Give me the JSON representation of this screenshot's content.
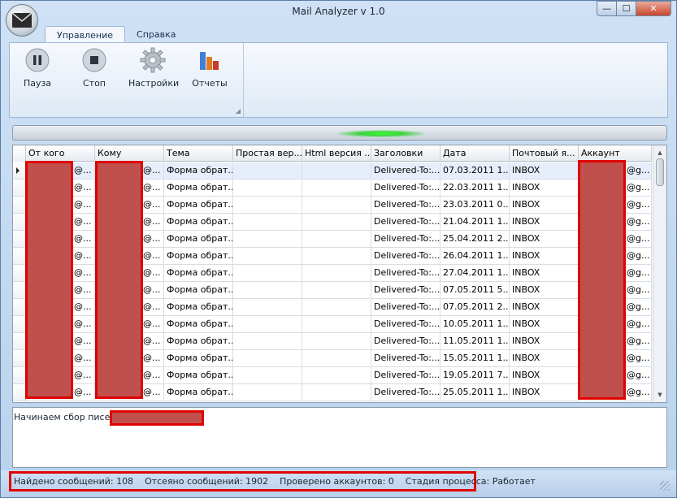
{
  "window": {
    "title": "Mail Analyzer v 1.0",
    "minimize": "—",
    "maximize": "☐",
    "close": "✕"
  },
  "tabs": [
    {
      "label": "Управление"
    },
    {
      "label": "Справка"
    }
  ],
  "ribbon": {
    "buttons": [
      {
        "label": "Пауза",
        "icon": "pause-icon"
      },
      {
        "label": "Стоп",
        "icon": "stop-icon"
      },
      {
        "label": "Настройки",
        "icon": "gear-icon"
      },
      {
        "label": "Отчеты",
        "icon": "chart-icon"
      }
    ]
  },
  "progress": {
    "indeterminate": true
  },
  "grid": {
    "columns": [
      "От кого",
      "Кому",
      "Тема",
      "Простая вер...",
      "Html версия ...",
      "Заголовки",
      "Дата",
      "Почтовый я...",
      "Аккаунт"
    ],
    "rows": [
      [
        "@...",
        "@...",
        "Форма обрат...",
        "",
        "",
        "Delivered-To:...",
        "07.03.2011 1...",
        "INBOX",
        "@g..."
      ],
      [
        "@...",
        "@...",
        "Форма обрат...",
        "",
        "",
        "Delivered-To:...",
        "22.03.2011 1...",
        "INBOX",
        "@g..."
      ],
      [
        "@...",
        "@...",
        "Форма обрат...",
        "",
        "",
        "Delivered-To:...",
        "23.03.2011 0...",
        "INBOX",
        "@g..."
      ],
      [
        "@...",
        "@...",
        "Форма обрат...",
        "",
        "",
        "Delivered-To:...",
        "21.04.2011 1...",
        "INBOX",
        "@g..."
      ],
      [
        "@...",
        "@...",
        "Форма обрат...",
        "",
        "",
        "Delivered-To:...",
        "25.04.2011 2...",
        "INBOX",
        "@g..."
      ],
      [
        "@...",
        "@...",
        "Форма обрат...",
        "",
        "",
        "Delivered-To:...",
        "26.04.2011 1...",
        "INBOX",
        "@g..."
      ],
      [
        "@...",
        "@...",
        "Форма обрат...",
        "",
        "",
        "Delivered-To:...",
        "27.04.2011 1...",
        "INBOX",
        "@g..."
      ],
      [
        "@...",
        "@...",
        "Форма обрат...",
        "",
        "",
        "Delivered-To:...",
        "07.05.2011 5...",
        "INBOX",
        "@g..."
      ],
      [
        "@...",
        "@...",
        "Форма обрат...",
        "",
        "",
        "Delivered-To:...",
        "07.05.2011 2...",
        "INBOX",
        "@g..."
      ],
      [
        "@...",
        "@...",
        "Форма обрат...",
        "",
        "",
        "Delivered-To:...",
        "10.05.2011 1...",
        "INBOX",
        "@g..."
      ],
      [
        "@...",
        "@...",
        "Форма обрат...",
        "",
        "",
        "Delivered-To:...",
        "11.05.2011 1...",
        "INBOX",
        "@g..."
      ],
      [
        "@...",
        "@...",
        "Форма обрат...",
        "",
        "",
        "Delivered-To:...",
        "15.05.2011 1...",
        "INBOX",
        "@g..."
      ],
      [
        "@...",
        "@...",
        "Форма обрат...",
        "",
        "",
        "Delivered-To:...",
        "19.05.2011 7...",
        "INBOX",
        "@g..."
      ],
      [
        "@...",
        "@...",
        "Форма обрат...",
        "",
        "",
        "Delivered-To:...",
        "25.05.2011 1...",
        "INBOX",
        "@g..."
      ]
    ]
  },
  "log": {
    "line": "Начинаем сбор писем с"
  },
  "status": {
    "found": "Найдено сообщений: 108",
    "filtered": "Отсеяно сообщений: 1902",
    "checked": "Проверено аккаунтов: 0",
    "stage": "Стадия процесса: Работает"
  },
  "colors": {
    "redaction": "#c0504d",
    "redaction_border": "#e00000",
    "progress_glow": "#3ad43a"
  }
}
